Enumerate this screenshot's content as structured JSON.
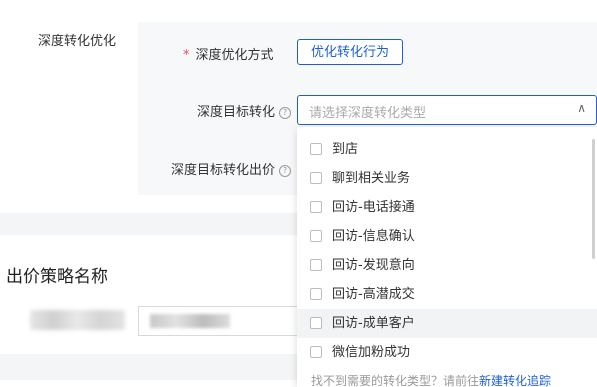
{
  "section": {
    "label": "深度转化优化"
  },
  "form": {
    "mode_label": "深度优化方式",
    "mode_button": "优化转化行为",
    "target_label": "深度目标转化",
    "target_placeholder": "请选择深度转化类型",
    "bid_label": "深度目标转化出价"
  },
  "strategy": {
    "title": "出价策略名称"
  },
  "dropdown": {
    "options": [
      {
        "label": "到店"
      },
      {
        "label": "聊到相关业务"
      },
      {
        "label": "回访-电话接通"
      },
      {
        "label": "回访-信息确认"
      },
      {
        "label": "回访-发现意向"
      },
      {
        "label": "回访-高潜成交"
      },
      {
        "label": "回访-成单客户"
      },
      {
        "label": "微信加粉成功"
      }
    ],
    "footer_text": "找不到需要的转化类型？请前往",
    "footer_link": "新建转化追踪"
  },
  "colors": {
    "accent": "#1f5fd3",
    "required": "#e34d59"
  },
  "icons": {
    "help": "help-circle-icon",
    "chevron": "chevron-up-icon",
    "checkbox": "checkbox-icon"
  }
}
